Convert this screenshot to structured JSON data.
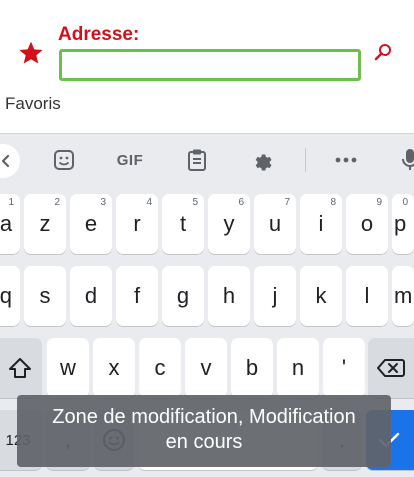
{
  "header": {
    "address_label": "Adresse:",
    "address_value": "",
    "favorites_label": "Favoris"
  },
  "colors": {
    "accent_red": "#d2101a",
    "input_border_green": "#6cc04a",
    "enter_blue": "#1a73e8"
  },
  "keyboard": {
    "toolbar": {
      "gif_label": "GIF",
      "icons": [
        "chevron-left-icon",
        "sticker-icon",
        "clipboard-icon",
        "gear-icon",
        "more-icon",
        "microphone-icon"
      ]
    },
    "row1": [
      {
        "label": "a",
        "hint": ""
      },
      {
        "label": "z",
        "hint": "2"
      },
      {
        "label": "e",
        "hint": "3"
      },
      {
        "label": "r",
        "hint": "4"
      },
      {
        "label": "t",
        "hint": "5"
      },
      {
        "label": "y",
        "hint": "6"
      },
      {
        "label": "u",
        "hint": "7"
      },
      {
        "label": "i",
        "hint": "8"
      },
      {
        "label": "o",
        "hint": "9"
      },
      {
        "label": "p",
        "hint": "0"
      }
    ],
    "row1_first_hint": "1",
    "row2": [
      "q",
      "s",
      "d",
      "f",
      "g",
      "h",
      "j",
      "k",
      "l",
      "m"
    ],
    "row3": [
      "w",
      "x",
      "c",
      "v",
      "b",
      "n",
      "'"
    ],
    "row4": {
      "symbols_label": "123",
      "comma_label": ",",
      "period_label": "."
    }
  },
  "toast": {
    "line1": "Zone de modification, Modification",
    "line2": "en cours"
  }
}
